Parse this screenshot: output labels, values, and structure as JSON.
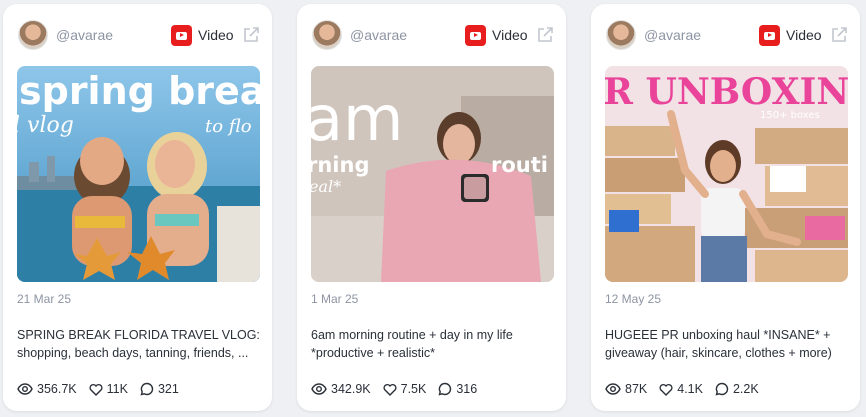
{
  "cards": [
    {
      "username": "@avarae",
      "type_label": "Video",
      "date": "21 Mar 25",
      "title": "SPRING BREAK FLORIDA TRAVEL VLOG: shopping, beach days, tanning, friends, ...",
      "thumb_text": [
        "spring break",
        "l vlog",
        "to flo"
      ],
      "views": "356.7K",
      "likes": "11K",
      "comments": "321"
    },
    {
      "username": "@avarae",
      "type_label": "Video",
      "date": "1 Mar 25",
      "title": "6am morning routine + day in my life *productive + realistic*",
      "thumb_text": [
        "am",
        "rning",
        "routi",
        "eal*"
      ],
      "views": "342.9K",
      "likes": "7.5K",
      "comments": "316"
    },
    {
      "username": "@avarae",
      "type_label": "Video",
      "date": "12 May 25",
      "title": "HUGEEE PR unboxing haul *INSANE* + giveaway (hair, skincare, clothes + more)",
      "thumb_text": [
        "R UNBOXIN",
        "150+ boxes"
      ],
      "views": "87K",
      "likes": "4.1K",
      "comments": "2.2K"
    }
  ]
}
